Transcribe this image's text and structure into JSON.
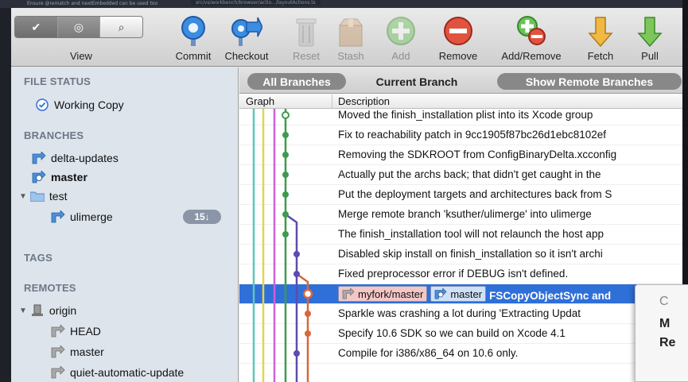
{
  "background": {
    "tooltip_text": "Ensure @rematch and nextEmbedded can be used too",
    "tab_path": "src/vs/workbench/browser/actio.../layoutActions.ts"
  },
  "toolbar": {
    "view_label": "View",
    "tools": [
      {
        "id": "commit",
        "label": "Commit",
        "enabled": true
      },
      {
        "id": "checkout",
        "label": "Checkout",
        "enabled": true
      },
      {
        "id": "reset",
        "label": "Reset",
        "enabled": false
      },
      {
        "id": "stash",
        "label": "Stash",
        "enabled": false
      },
      {
        "id": "add",
        "label": "Add",
        "enabled": false
      },
      {
        "id": "remove",
        "label": "Remove",
        "enabled": true
      },
      {
        "id": "addremove",
        "label": "Add/Remove",
        "enabled": true
      },
      {
        "id": "fetch",
        "label": "Fetch",
        "enabled": true
      },
      {
        "id": "pull",
        "label": "Pull",
        "enabled": true
      }
    ],
    "view_segment": {
      "check": "✔",
      "eye": "◎",
      "search": "⌕"
    }
  },
  "sidebar": {
    "file_status": {
      "heading": "FILE STATUS",
      "items": [
        {
          "label": "Working Copy"
        }
      ]
    },
    "branches": {
      "heading": "BRANCHES",
      "items": [
        {
          "label": "delta-updates",
          "bold": false
        },
        {
          "label": "master",
          "bold": true
        }
      ],
      "folder": {
        "label": "test",
        "children": [
          {
            "label": "ulimerge",
            "badge": "15↓"
          }
        ]
      }
    },
    "tags": {
      "heading": "TAGS"
    },
    "remotes": {
      "heading": "REMOTES",
      "origin": {
        "label": "origin",
        "children": [
          {
            "label": "HEAD"
          },
          {
            "label": "master"
          },
          {
            "label": "quiet-automatic-update"
          }
        ]
      }
    }
  },
  "main": {
    "filters": {
      "all_branches": "All Branches",
      "current_branch": "Current Branch",
      "show_remote": "Show Remote Branches"
    },
    "columns": {
      "graph": "Graph",
      "description": "Description"
    },
    "commits": [
      {
        "desc": "Moved the finish_installation plist into its Xcode group"
      },
      {
        "desc": "Fix to reachability patch in 9cc1905f87bc26d1ebc8102ef"
      },
      {
        "desc": "Removing the SDKROOT from ConfigBinaryDelta.xcconfig"
      },
      {
        "desc": "Actually put the archs back; that didn't get caught in the"
      },
      {
        "desc": "Put the deployment targets and architectures back from S"
      },
      {
        "desc": "Merge remote branch 'ksuther/ulimerge' into ulimerge"
      },
      {
        "desc": "The finish_installation tool will not relaunch the host app"
      },
      {
        "desc": "Disabled skip install on finish_installation so it isn't archi"
      },
      {
        "desc": "Fixed preprocessor error if DEBUG isn't defined."
      },
      {
        "desc": "FSCopyObjectSync and",
        "selected": true,
        "tags": [
          {
            "label": "myfork/master",
            "kind": "remote"
          },
          {
            "label": "master",
            "kind": "local"
          }
        ]
      },
      {
        "desc": "Sparkle was crashing a lot during 'Extracting Updat"
      },
      {
        "desc": "Specify 10.6 SDK so we can build on Xcode 4.1"
      },
      {
        "desc": "Compile for i386/x86_64 on 10.6 only."
      }
    ]
  },
  "popover": {
    "line1": "C",
    "line2": "M",
    "line3": "Re"
  },
  "colors": {
    "selection": "#2f6fd8",
    "lane_teal": "#5fc6b8",
    "lane_green": "#3f9a4c",
    "lane_magenta": "#d05fd6",
    "lane_purple": "#5c4bb0",
    "lane_orange": "#d8673a",
    "lane_yellow": "#e3d44c"
  }
}
